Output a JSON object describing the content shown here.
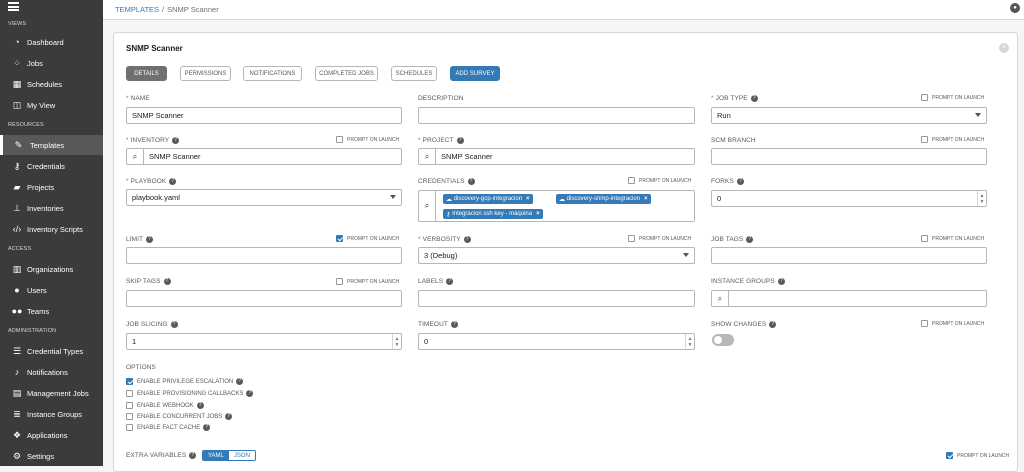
{
  "sidebar": {
    "sections": {
      "views": "VIEWS",
      "resources": "RESOURCES",
      "access": "ACCESS",
      "administration": "ADMINISTRATION"
    },
    "items": [
      {
        "label": "Dashboard",
        "icon": "dashboard-icon"
      },
      {
        "label": "Jobs",
        "icon": "spinner-icon"
      },
      {
        "label": "Schedules",
        "icon": "calendar-icon"
      },
      {
        "label": "My View",
        "icon": "columns-icon"
      },
      {
        "label": "Templates",
        "icon": "pencil-icon"
      },
      {
        "label": "Credentials",
        "icon": "key-icon"
      },
      {
        "label": "Projects",
        "icon": "folder-icon"
      },
      {
        "label": "Inventories",
        "icon": "sitemap-icon"
      },
      {
        "label": "Inventory Scripts",
        "icon": "code-icon"
      },
      {
        "label": "Organizations",
        "icon": "building-icon"
      },
      {
        "label": "Users",
        "icon": "user-icon"
      },
      {
        "label": "Teams",
        "icon": "users-icon"
      },
      {
        "label": "Credential Types",
        "icon": "list-icon"
      },
      {
        "label": "Notifications",
        "icon": "bell-icon"
      },
      {
        "label": "Management Jobs",
        "icon": "briefcase-icon"
      },
      {
        "label": "Instance Groups",
        "icon": "server-icon"
      },
      {
        "label": "Applications",
        "icon": "cubes-icon"
      },
      {
        "label": "Settings",
        "icon": "gear-icon"
      }
    ]
  },
  "breadcrumb": {
    "parent": "TEMPLATES",
    "sep": "/",
    "current": "SNMP Scanner"
  },
  "panel": {
    "title": "SNMP Scanner",
    "tabs": [
      "DETAILS",
      "PERMISSIONS",
      "NOTIFICATIONS",
      "COMPLETED JOBS",
      "SCHEDULES",
      "ADD SURVEY"
    ]
  },
  "form": {
    "prompt_on_launch": "PROMPT ON LAUNCH",
    "name": {
      "label": "NAME",
      "value": "SNMP Scanner"
    },
    "description": {
      "label": "DESCRIPTION",
      "value": ""
    },
    "job_type": {
      "label": "JOB TYPE",
      "value": "Run"
    },
    "inventory": {
      "label": "INVENTORY",
      "value": "SNMP Scanner"
    },
    "project": {
      "label": "PROJECT",
      "value": "SNMP Scanner"
    },
    "scm_branch": {
      "label": "SCM BRANCH",
      "value": ""
    },
    "playbook": {
      "label": "PLAYBOOK",
      "value": "playbook.yaml"
    },
    "credentials": {
      "label": "CREDENTIALS",
      "tags": [
        "discovery-gcp-integracion",
        "discovery-snmp-integracion",
        "Integracion ssh key - máquina"
      ]
    },
    "forks": {
      "label": "FORKS",
      "value": "0"
    },
    "limit": {
      "label": "LIMIT",
      "value": ""
    },
    "verbosity": {
      "label": "VERBOSITY",
      "value": "3 (Debug)"
    },
    "job_tags": {
      "label": "JOB TAGS",
      "value": ""
    },
    "skip_tags": {
      "label": "SKIP TAGS",
      "value": ""
    },
    "labels": {
      "label": "LABELS",
      "value": ""
    },
    "instance_groups": {
      "label": "INSTANCE GROUPS",
      "value": ""
    },
    "job_slicing": {
      "label": "JOB SLICING",
      "value": "1"
    },
    "timeout": {
      "label": "TIMEOUT",
      "value": "0"
    },
    "show_changes": {
      "label": "SHOW CHANGES",
      "enabled": false
    },
    "options": {
      "label": "OPTIONS",
      "items": [
        {
          "label": "ENABLE PRIVILEGE ESCALATION",
          "checked": true
        },
        {
          "label": "ENABLE PROVISIONING CALLBACKS",
          "checked": false
        },
        {
          "label": "ENABLE WEBHOOK",
          "checked": false
        },
        {
          "label": "ENABLE CONCURRENT JOBS",
          "checked": false
        },
        {
          "label": "ENABLE FACT CACHE",
          "checked": false
        }
      ]
    },
    "extra_variables": {
      "label": "EXTRA VARIABLES",
      "yaml": "YAML",
      "json": "JSON"
    }
  }
}
